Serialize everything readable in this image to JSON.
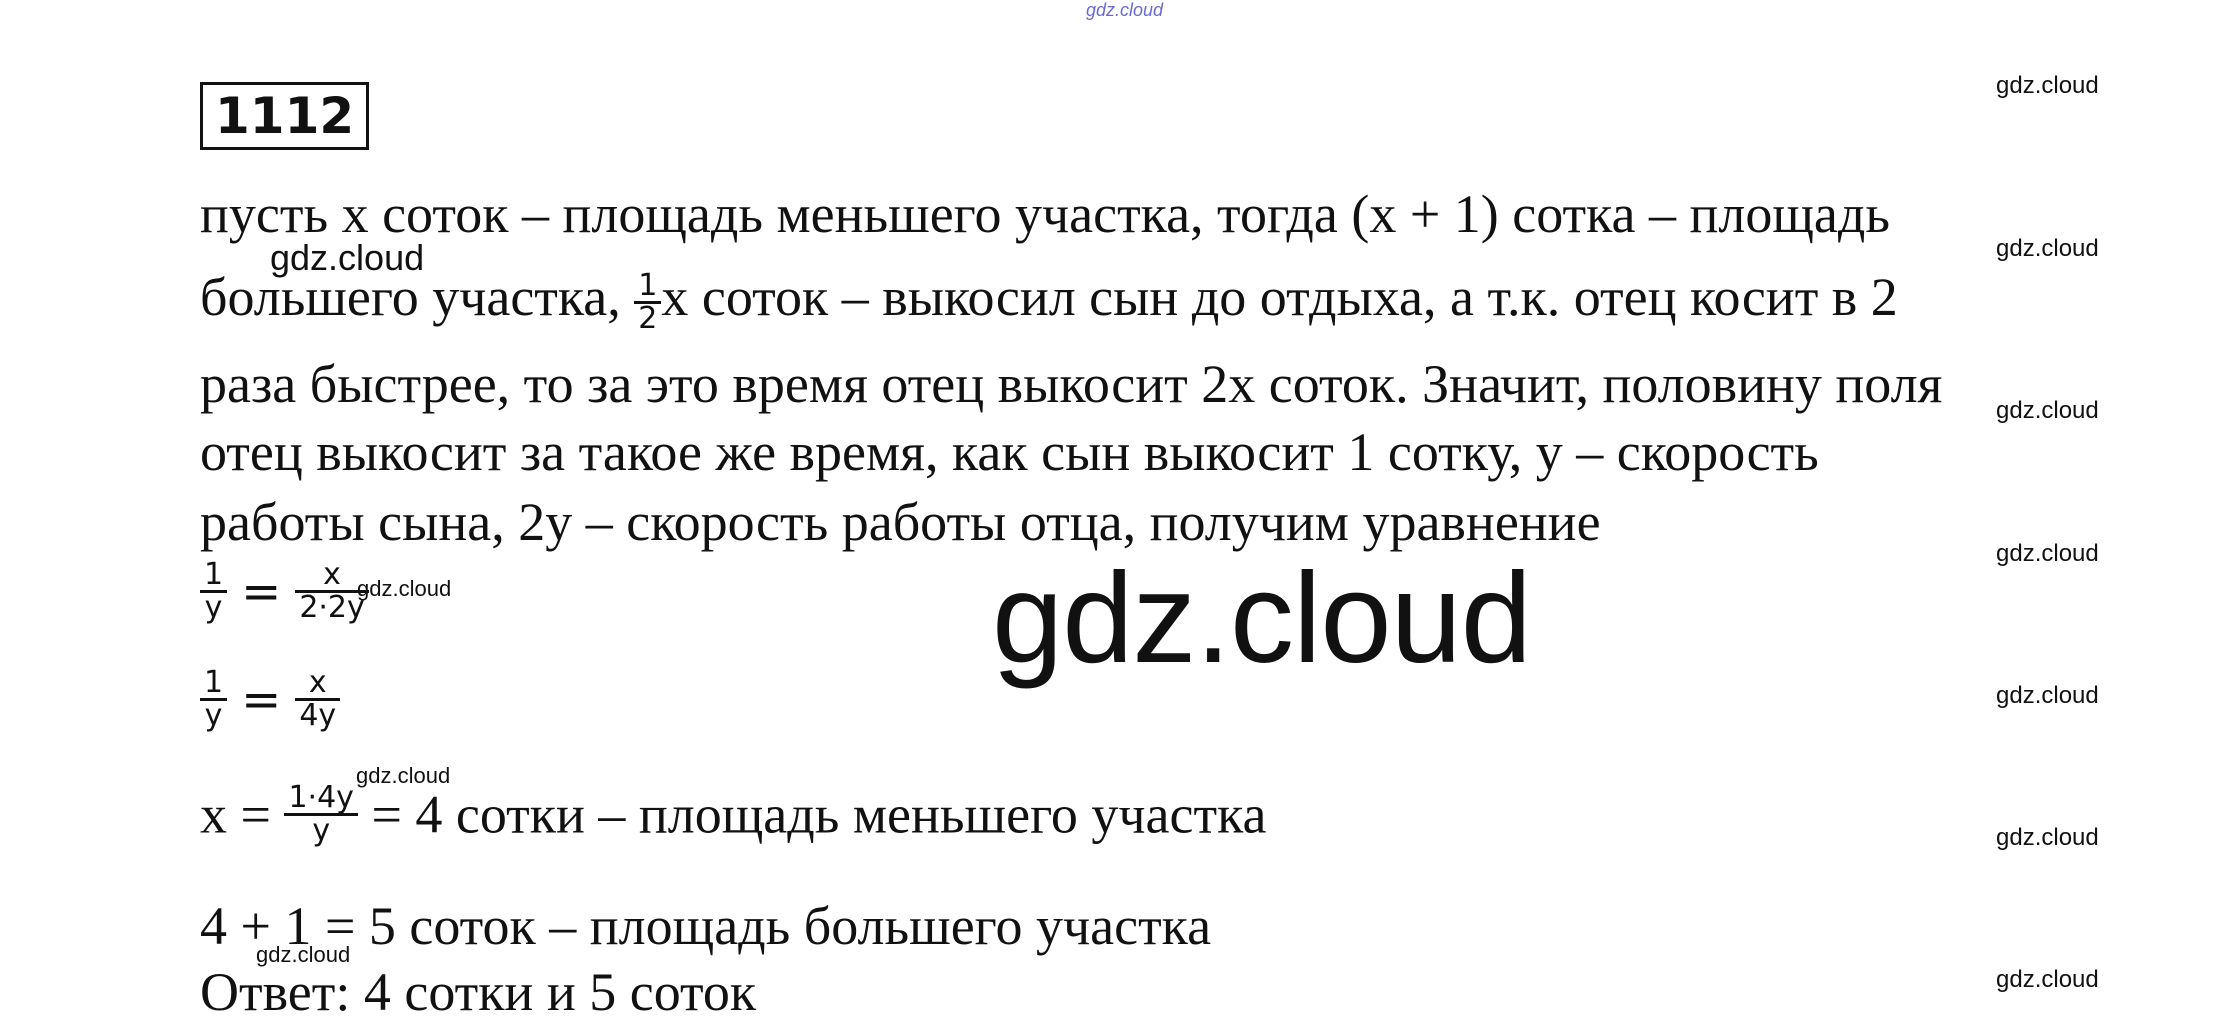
{
  "watermarks": {
    "top": "gdz.cloud",
    "small": "gdz.cloud",
    "big": "gdz.cloud"
  },
  "task_number": "1112",
  "text": {
    "l1": "пусть x соток – площадь меньшего участка, тогда (x + 1) сотка – площадь",
    "l2a": "большего участка, ",
    "l2b": "x соток – выкосил сын до отдыха, а т.к. отец косит в 2",
    "l3": "раза быстрее, то за это время отец выкосит 2x соток. Значит, половину поля",
    "l4": "отец выкосит за такое же время, как сын выкосит 1 сотку, y – скорость",
    "l5": "работы сына, 2y – скорость работы отца, получим уравнение",
    "l2frac_n": "1",
    "l2frac_d": "2"
  },
  "equations": {
    "eq1": {
      "ln": "1",
      "ld": "y",
      "op": "=",
      "rn": "x",
      "rd": "2·2y"
    },
    "eq2": {
      "ln": "1",
      "ld": "y",
      "op": "=",
      "rn": "x",
      "rd": "4y"
    },
    "eq3": {
      "pre": "x =",
      "fn": "1·4y",
      "fd": "y",
      "post": "= 4 сотки – площадь меньшего участка"
    },
    "eq4": "4 + 1 = 5 соток – площадь большего участка",
    "answer": "Ответ: 4 сотки и 5 соток"
  }
}
